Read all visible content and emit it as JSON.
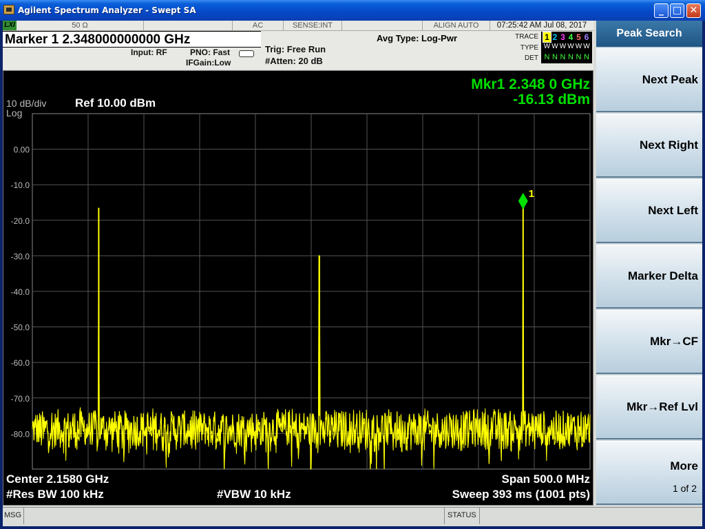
{
  "window": {
    "title": "Agilent Spectrum Analyzer - Swept SA",
    "minimize": "_",
    "maximize": "□",
    "close": "✕"
  },
  "status_bar_top": {
    "lxi": "LXI",
    "impedance": "50 Ω",
    "coupling": "AC",
    "sense": "SENSE:INT",
    "align": "ALIGN AUTO",
    "datetime": "07:25:42 AM Jul 08, 2017"
  },
  "marker_readout": "Marker 1  2.348000000000 GHz",
  "settings": {
    "input": "Input: RF",
    "pno": "PNO: Fast",
    "ifgain": "IFGain:Low",
    "trig": "Trig: Free Run",
    "atten": "#Atten: 20 dB",
    "avg_type": "Avg Type: Log-Pwr"
  },
  "trace_legend": {
    "trace_label": "TRACE",
    "type_label": "TYPE",
    "det_label": "DET",
    "numbers": [
      "1",
      "2",
      "3",
      "4",
      "5",
      "6"
    ],
    "number_colors": [
      "#ffff00",
      "#00c8ff",
      "#ff40ff",
      "#40ff40",
      "#ff7070",
      "#a080ff"
    ],
    "type_values": [
      "W",
      "W",
      "W",
      "W",
      "W",
      "W"
    ],
    "det_values": [
      "N",
      "N",
      "N",
      "N",
      "N",
      "N"
    ]
  },
  "display": {
    "scale": "10 dB/div",
    "scale_type": "Log",
    "ref_level": "Ref 10.00 dBm",
    "marker_freq": "Mkr1 2.348 0 GHz",
    "marker_amp": "-16.13 dBm",
    "marker_label": "1",
    "center": "Center 2.1580 GHz",
    "span": "Span 500.0 MHz",
    "rbw": "#Res BW 100 kHz",
    "vbw": "#VBW 10 kHz",
    "sweep": "Sweep  393 ms (1001 pts)",
    "y_ticks": [
      "0.00",
      "-10.0",
      "-20.0",
      "-30.0",
      "-40.0",
      "-50.0",
      "-60.0",
      "-70.0",
      "-80.0"
    ]
  },
  "colors": {
    "trace": "#ffff00",
    "marker": "#00e000",
    "marker_text": "#00e000",
    "graticule": "#555555",
    "softkey_title_bg": "#2f6a9a"
  },
  "chart_data": {
    "type": "line",
    "title": "",
    "xlabel": "",
    "ylabel": "",
    "ylim": [
      -90,
      10
    ],
    "xlim": [
      1.908,
      2.408
    ],
    "noise_floor_dbm": -75,
    "peaks": [
      {
        "freq_ghz": 1.9675,
        "amp_dbm": -16.5
      },
      {
        "freq_ghz": 2.1653,
        "amp_dbm": -30.0
      },
      {
        "freq_ghz": 2.348,
        "amp_dbm": -16.13
      }
    ],
    "grid": true
  },
  "softkeys": {
    "title": "Peak Search",
    "items": [
      {
        "label": "Next Peak"
      },
      {
        "label": "Next Right"
      },
      {
        "label": "Next Left"
      },
      {
        "label": "Marker Delta"
      },
      {
        "label": "Mkr→CF"
      },
      {
        "label": "Mkr→Ref Lvl"
      },
      {
        "label": "More",
        "sub": "1 of 2"
      }
    ]
  },
  "bottom": {
    "msg": "MSG",
    "status": "STATUS"
  }
}
